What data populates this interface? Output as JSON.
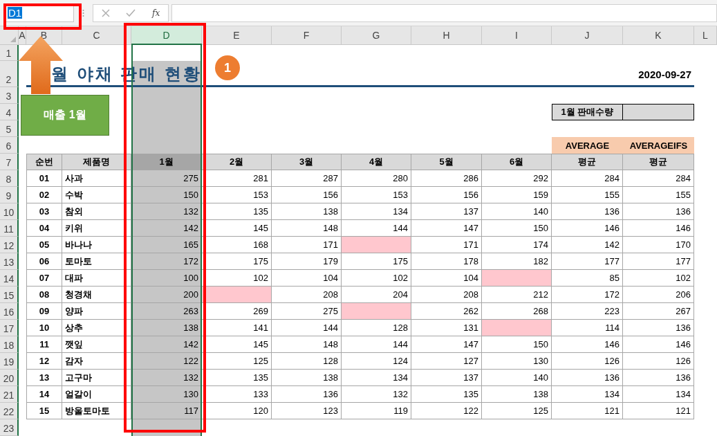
{
  "formula_bar": {
    "name_box": "D1",
    "function_label": "fx"
  },
  "columns": [
    {
      "label": "A",
      "selected": false
    },
    {
      "label": "B",
      "selected": false
    },
    {
      "label": "C",
      "selected": false
    },
    {
      "label": "D",
      "selected": true
    },
    {
      "label": "E",
      "selected": false
    },
    {
      "label": "F",
      "selected": false
    },
    {
      "label": "G",
      "selected": false
    },
    {
      "label": "H",
      "selected": false
    },
    {
      "label": "I",
      "selected": false
    },
    {
      "label": "J",
      "selected": false
    },
    {
      "label": "K",
      "selected": false
    },
    {
      "label": "L",
      "selected": false
    }
  ],
  "rows": [
    "1",
    "2",
    "3",
    "4",
    "5",
    "6",
    "7",
    "8",
    "9",
    "10",
    "11",
    "12",
    "13",
    "14",
    "15",
    "16",
    "17",
    "18",
    "19",
    "20",
    "21",
    "22",
    "23"
  ],
  "sheet": {
    "title": "월 야채 판매 현황",
    "date": "2020-09-27",
    "lookup_label": "1월 판매수량",
    "function_tags": [
      "AVERAGE",
      "AVERAGEIFS"
    ],
    "table": {
      "headers": [
        "순번",
        "제품명",
        "1월",
        "2월",
        "3월",
        "4월",
        "5월",
        "6월",
        "평균",
        "평균"
      ],
      "rows": [
        {
          "no": "01",
          "name": "사과",
          "cells": [
            {
              "text": "275",
              "highlighted": false
            },
            {
              "text": "281",
              "highlighted": false
            },
            {
              "text": "287",
              "highlighted": false
            },
            {
              "text": "280",
              "highlighted": false
            },
            {
              "text": "286",
              "highlighted": false
            },
            {
              "text": "292",
              "highlighted": false
            },
            {
              "text": "284",
              "highlighted": false
            },
            {
              "text": "284",
              "highlighted": false
            }
          ]
        },
        {
          "no": "02",
          "name": "수박",
          "cells": [
            {
              "text": "150",
              "highlighted": false
            },
            {
              "text": "153",
              "highlighted": false
            },
            {
              "text": "156",
              "highlighted": false
            },
            {
              "text": "153",
              "highlighted": false
            },
            {
              "text": "156",
              "highlighted": false
            },
            {
              "text": "159",
              "highlighted": false
            },
            {
              "text": "155",
              "highlighted": false
            },
            {
              "text": "155",
              "highlighted": false
            }
          ]
        },
        {
          "no": "03",
          "name": "참외",
          "cells": [
            {
              "text": "132",
              "highlighted": false
            },
            {
              "text": "135",
              "highlighted": false
            },
            {
              "text": "138",
              "highlighted": false
            },
            {
              "text": "134",
              "highlighted": false
            },
            {
              "text": "137",
              "highlighted": false
            },
            {
              "text": "140",
              "highlighted": false
            },
            {
              "text": "136",
              "highlighted": false
            },
            {
              "text": "136",
              "highlighted": false
            }
          ]
        },
        {
          "no": "04",
          "name": "키위",
          "cells": [
            {
              "text": "142",
              "highlighted": false
            },
            {
              "text": "145",
              "highlighted": false
            },
            {
              "text": "148",
              "highlighted": false
            },
            {
              "text": "144",
              "highlighted": false
            },
            {
              "text": "147",
              "highlighted": false
            },
            {
              "text": "150",
              "highlighted": false
            },
            {
              "text": "146",
              "highlighted": false
            },
            {
              "text": "146",
              "highlighted": false
            }
          ]
        },
        {
          "no": "05",
          "name": "바나나",
          "cells": [
            {
              "text": "165",
              "highlighted": false
            },
            {
              "text": "168",
              "highlighted": false
            },
            {
              "text": "171",
              "highlighted": false
            },
            {
              "highlighted": true
            },
            {
              "text": "171",
              "highlighted": false
            },
            {
              "text": "174",
              "highlighted": false
            },
            {
              "text": "142",
              "highlighted": false
            },
            {
              "text": "170",
              "highlighted": false
            }
          ]
        },
        {
          "no": "06",
          "name": "토마토",
          "cells": [
            {
              "text": "172",
              "highlighted": false
            },
            {
              "text": "175",
              "highlighted": false
            },
            {
              "text": "179",
              "highlighted": false
            },
            {
              "text": "175",
              "highlighted": false
            },
            {
              "text": "178",
              "highlighted": false
            },
            {
              "text": "182",
              "highlighted": false
            },
            {
              "text": "177",
              "highlighted": false
            },
            {
              "text": "177",
              "highlighted": false
            }
          ]
        },
        {
          "no": "07",
          "name": "대파",
          "cells": [
            {
              "text": "100",
              "highlighted": false
            },
            {
              "text": "102",
              "highlighted": false
            },
            {
              "text": "104",
              "highlighted": false
            },
            {
              "text": "102",
              "highlighted": false
            },
            {
              "text": "104",
              "highlighted": false
            },
            {
              "highlighted": true
            },
            {
              "text": "85",
              "highlighted": false
            },
            {
              "text": "102",
              "highlighted": false
            }
          ]
        },
        {
          "no": "08",
          "name": "청경채",
          "cells": [
            {
              "text": "200",
              "highlighted": false
            },
            {
              "highlighted": true
            },
            {
              "text": "208",
              "highlighted": false
            },
            {
              "text": "204",
              "highlighted": false
            },
            {
              "text": "208",
              "highlighted": false
            },
            {
              "text": "212",
              "highlighted": false
            },
            {
              "text": "172",
              "highlighted": false
            },
            {
              "text": "206",
              "highlighted": false
            }
          ]
        },
        {
          "no": "09",
          "name": "양파",
          "cells": [
            {
              "text": "263",
              "highlighted": false
            },
            {
              "text": "269",
              "highlighted": false
            },
            {
              "text": "275",
              "highlighted": false
            },
            {
              "highlighted": true
            },
            {
              "text": "262",
              "highlighted": false
            },
            {
              "text": "268",
              "highlighted": false
            },
            {
              "text": "223",
              "highlighted": false
            },
            {
              "text": "267",
              "highlighted": false
            }
          ]
        },
        {
          "no": "10",
          "name": "상추",
          "cells": [
            {
              "text": "138",
              "highlighted": false
            },
            {
              "text": "141",
              "highlighted": false
            },
            {
              "text": "144",
              "highlighted": false
            },
            {
              "text": "128",
              "highlighted": false
            },
            {
              "text": "131",
              "highlighted": false
            },
            {
              "highlighted": true
            },
            {
              "text": "114",
              "highlighted": false
            },
            {
              "text": "136",
              "highlighted": false
            }
          ]
        },
        {
          "no": "11",
          "name": "깻잎",
          "cells": [
            {
              "text": "142",
              "highlighted": false
            },
            {
              "text": "145",
              "highlighted": false
            },
            {
              "text": "148",
              "highlighted": false
            },
            {
              "text": "144",
              "highlighted": false
            },
            {
              "text": "147",
              "highlighted": false
            },
            {
              "text": "150",
              "highlighted": false
            },
            {
              "text": "146",
              "highlighted": false
            },
            {
              "text": "146",
              "highlighted": false
            }
          ]
        },
        {
          "no": "12",
          "name": "감자",
          "cells": [
            {
              "text": "122",
              "highlighted": false
            },
            {
              "text": "125",
              "highlighted": false
            },
            {
              "text": "128",
              "highlighted": false
            },
            {
              "text": "124",
              "highlighted": false
            },
            {
              "text": "127",
              "highlighted": false
            },
            {
              "text": "130",
              "highlighted": false
            },
            {
              "text": "126",
              "highlighted": false
            },
            {
              "text": "126",
              "highlighted": false
            }
          ]
        },
        {
          "no": "13",
          "name": "고구마",
          "cells": [
            {
              "text": "132",
              "highlighted": false
            },
            {
              "text": "135",
              "highlighted": false
            },
            {
              "text": "138",
              "highlighted": false
            },
            {
              "text": "134",
              "highlighted": false
            },
            {
              "text": "137",
              "highlighted": false
            },
            {
              "text": "140",
              "highlighted": false
            },
            {
              "text": "136",
              "highlighted": false
            },
            {
              "text": "136",
              "highlighted": false
            }
          ]
        },
        {
          "no": "14",
          "name": "얼갈이",
          "cells": [
            {
              "text": "130",
              "highlighted": false
            },
            {
              "text": "133",
              "highlighted": false
            },
            {
              "text": "136",
              "highlighted": false
            },
            {
              "text": "132",
              "highlighted": false
            },
            {
              "text": "135",
              "highlighted": false
            },
            {
              "text": "138",
              "highlighted": false
            },
            {
              "text": "134",
              "highlighted": false
            },
            {
              "text": "134",
              "highlighted": false
            }
          ]
        },
        {
          "no": "15",
          "name": "방울토마토",
          "cells": [
            {
              "text": "117",
              "highlighted": false
            },
            {
              "text": "120",
              "highlighted": false
            },
            {
              "text": "123",
              "highlighted": false
            },
            {
              "text": "119",
              "highlighted": false
            },
            {
              "text": "122",
              "highlighted": false
            },
            {
              "text": "125",
              "highlighted": false
            },
            {
              "text": "121",
              "highlighted": false
            },
            {
              "text": "121",
              "highlighted": false
            }
          ]
        }
      ]
    }
  },
  "annotations": {
    "callout": "매출 1월",
    "step_badge": "1"
  }
}
